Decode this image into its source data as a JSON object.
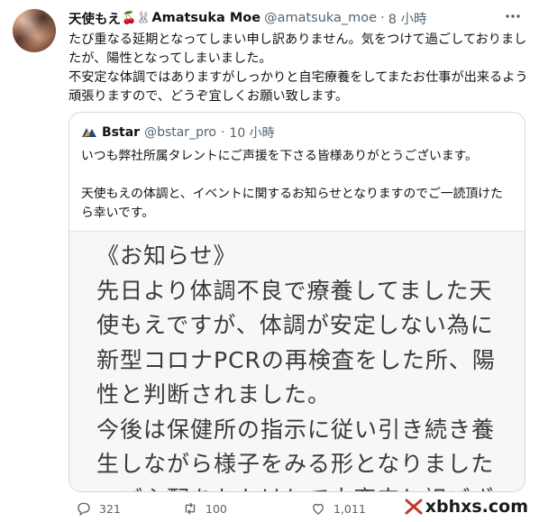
{
  "author": {
    "display_name": "天使もえ",
    "emoji": "🍒🐰",
    "display_name_en": "Amatsuka Moe",
    "handle": "@amatsuka_moe",
    "time": "8 小時",
    "more_icon": "more-icon"
  },
  "tweet_lines": [
    "たび重なる延期となってしまい申し訳ありません。気をつけて過ごしておりまし",
    "たが、陽性となってしまいました。",
    "不安定な体調ではありますがしっかりと自宅療養をしてまたお仕事が出来るよう",
    "頑張りますので、どうぞ宜しくお願い致します。"
  ],
  "quote": {
    "name": "Bstar",
    "handle": "@bstar_pro",
    "time": "10 小時",
    "lines": [
      "いつも弊社所属タレントにご声援を下さる皆様ありがとうございます。",
      "",
      "天使もえの体調と、イベントに関するお知らせとなりますのでご一読頂けた",
      "ら幸いです。"
    ],
    "image_lines": [
      "《お知らせ》",
      "先日より体調不良で療養してました天",
      "使もえですが、体調が安定しない為に",
      "新型コロナPCRの再検査をした所、陽",
      "性と判断されました。",
      "今後は保健所の指示に従い引き続き養",
      "生しながら様子をみる形となりました",
      "。ご心配をおかけして大変申し訳ござ"
    ]
  },
  "actions": {
    "replies": "321",
    "retweets": "100",
    "likes": "1,011"
  },
  "watermark": "xbhxs.com"
}
